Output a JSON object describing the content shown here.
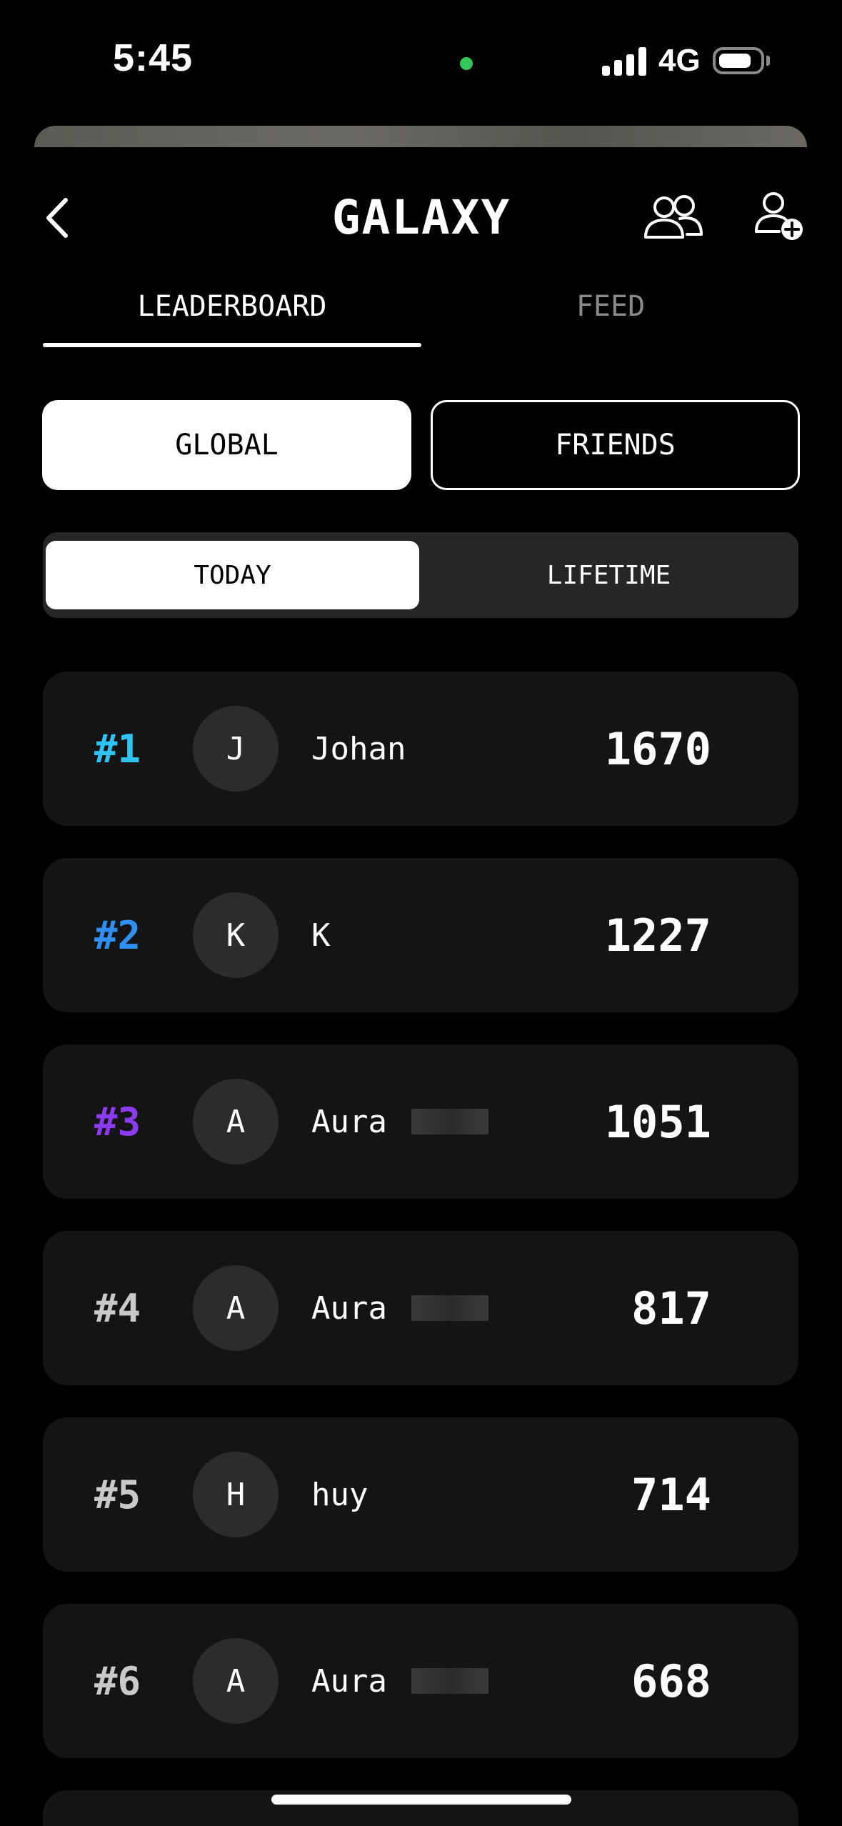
{
  "status_bar": {
    "time": "5:45",
    "network": "4G",
    "battery_level": 0.7,
    "camera_indicator_color": "#34c759"
  },
  "header": {
    "title": "GALAXY",
    "back_icon": "chevron-left-icon",
    "friends_icon": "people-icon",
    "add_friend_icon": "person-plus-icon"
  },
  "tabs": [
    {
      "label": "LEADERBOARD",
      "active": true
    },
    {
      "label": "FEED",
      "active": false
    }
  ],
  "scope": {
    "global_label": "GLOBAL",
    "friends_label": "FRIENDS",
    "selected": "GLOBAL"
  },
  "period": {
    "today_label": "TODAY",
    "lifetime_label": "LIFETIME",
    "selected": "TODAY"
  },
  "rank_colors": {
    "first": "#2ec4f5",
    "second": "#2f8ff3",
    "third": "#8b3cf0",
    "default": "#c9c9c9"
  },
  "leaderboard": [
    {
      "rank": "#1",
      "initial": "J",
      "name": "Johan",
      "score": "1670"
    },
    {
      "rank": "#2",
      "initial": "K",
      "name": "K",
      "score": "1227"
    },
    {
      "rank": "#3",
      "initial": "A",
      "name": "Aura",
      "score": "1051"
    },
    {
      "rank": "#4",
      "initial": "A",
      "name": "Aura",
      "score": "817"
    },
    {
      "rank": "#5",
      "initial": "H",
      "name": "huy",
      "score": "714"
    },
    {
      "rank": "#6",
      "initial": "A",
      "name": "Aura",
      "score": "668"
    }
  ]
}
